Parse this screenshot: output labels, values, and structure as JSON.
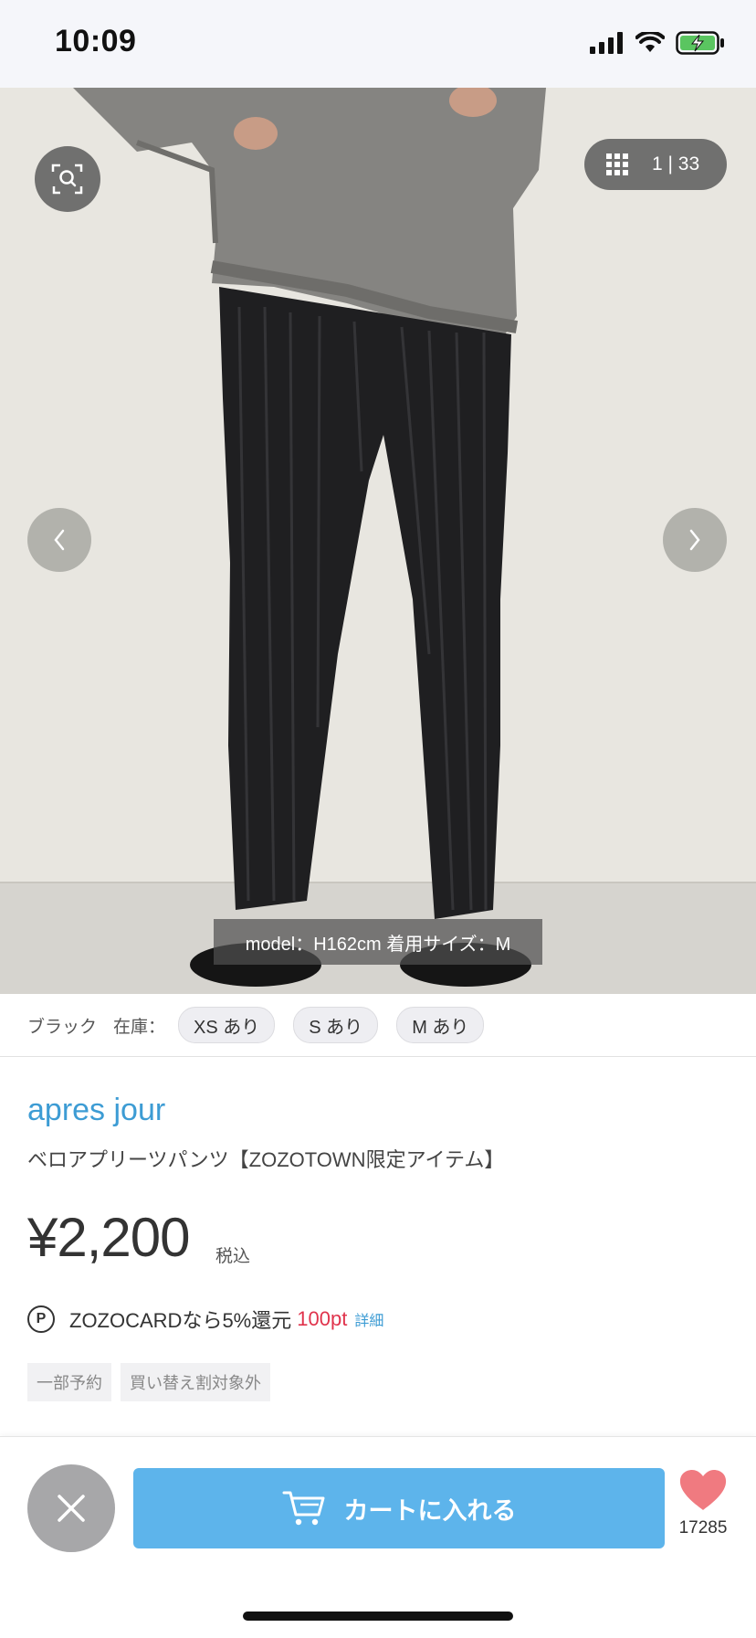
{
  "status_bar": {
    "time": "10:09"
  },
  "gallery": {
    "counter": "1 | 33",
    "caption": "model：H162cm 着用サイズ：M"
  },
  "stock": {
    "color": "ブラック",
    "label": "在庫：",
    "sizes": [
      "XS あり",
      "S あり",
      "M あり"
    ]
  },
  "product": {
    "brand": "apres jour",
    "name": "ベロアプリーツパンツ【ZOZOTOWN限定アイテム】",
    "price": "¥2,200",
    "tax_label": "税込",
    "points_icon": "P",
    "points_text": "ZOZOCARDなら5%還元",
    "points_value": "100pt",
    "points_detail": "詳細",
    "tags": [
      "一部予約",
      "買い替え割対象外"
    ]
  },
  "bottom_bar": {
    "cart_label": "カートに入れる",
    "favorite_count": "17285"
  },
  "colors": {
    "accent_blue": "#3d9cd4",
    "cart_button": "#5db4eb",
    "heart": "#f07a80",
    "points_red": "#e0334c"
  }
}
